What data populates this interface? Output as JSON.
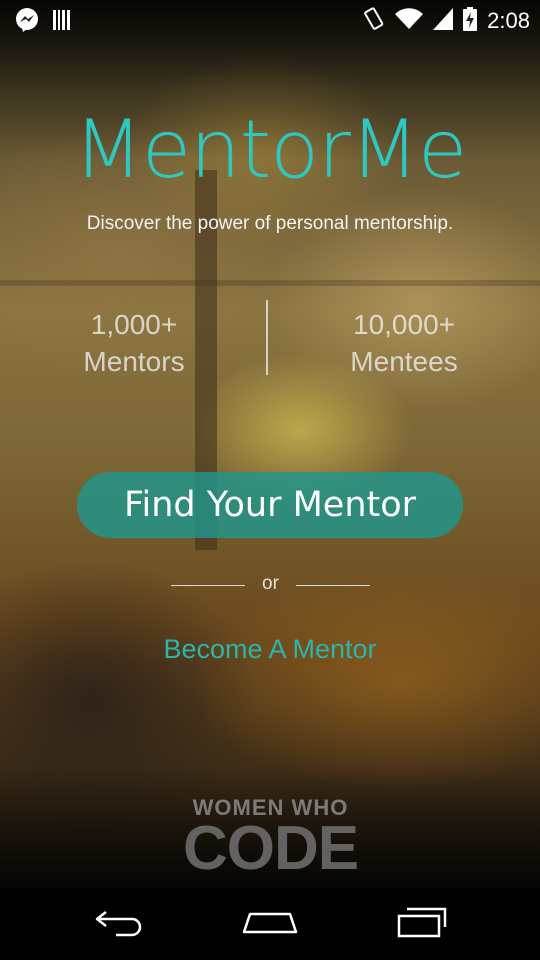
{
  "status_bar": {
    "time": "2:08",
    "left_icons": [
      "messenger-icon",
      "barcode-icon"
    ],
    "right_icons": [
      "vibrate-icon",
      "wifi-icon",
      "signal-icon",
      "battery-charging-icon"
    ]
  },
  "hero": {
    "title": "MentorMe",
    "tagline": "Discover the power of personal mentorship."
  },
  "stats": [
    {
      "count": "1,000+",
      "label": "Mentors"
    },
    {
      "count": "10,000+",
      "label": "Mentees"
    }
  ],
  "actions": {
    "find_mentor_label": "Find Your Mentor",
    "or_label": "or",
    "become_mentor_label": "Become A Mentor"
  },
  "branding": {
    "line1": "WOMEN WHO",
    "line2": "CODE"
  },
  "nav": [
    "back-icon",
    "home-icon",
    "recent-apps-icon"
  ],
  "colors": {
    "accent": "#2ec8c0",
    "button": "#20968c",
    "link": "#2ab5ad"
  }
}
